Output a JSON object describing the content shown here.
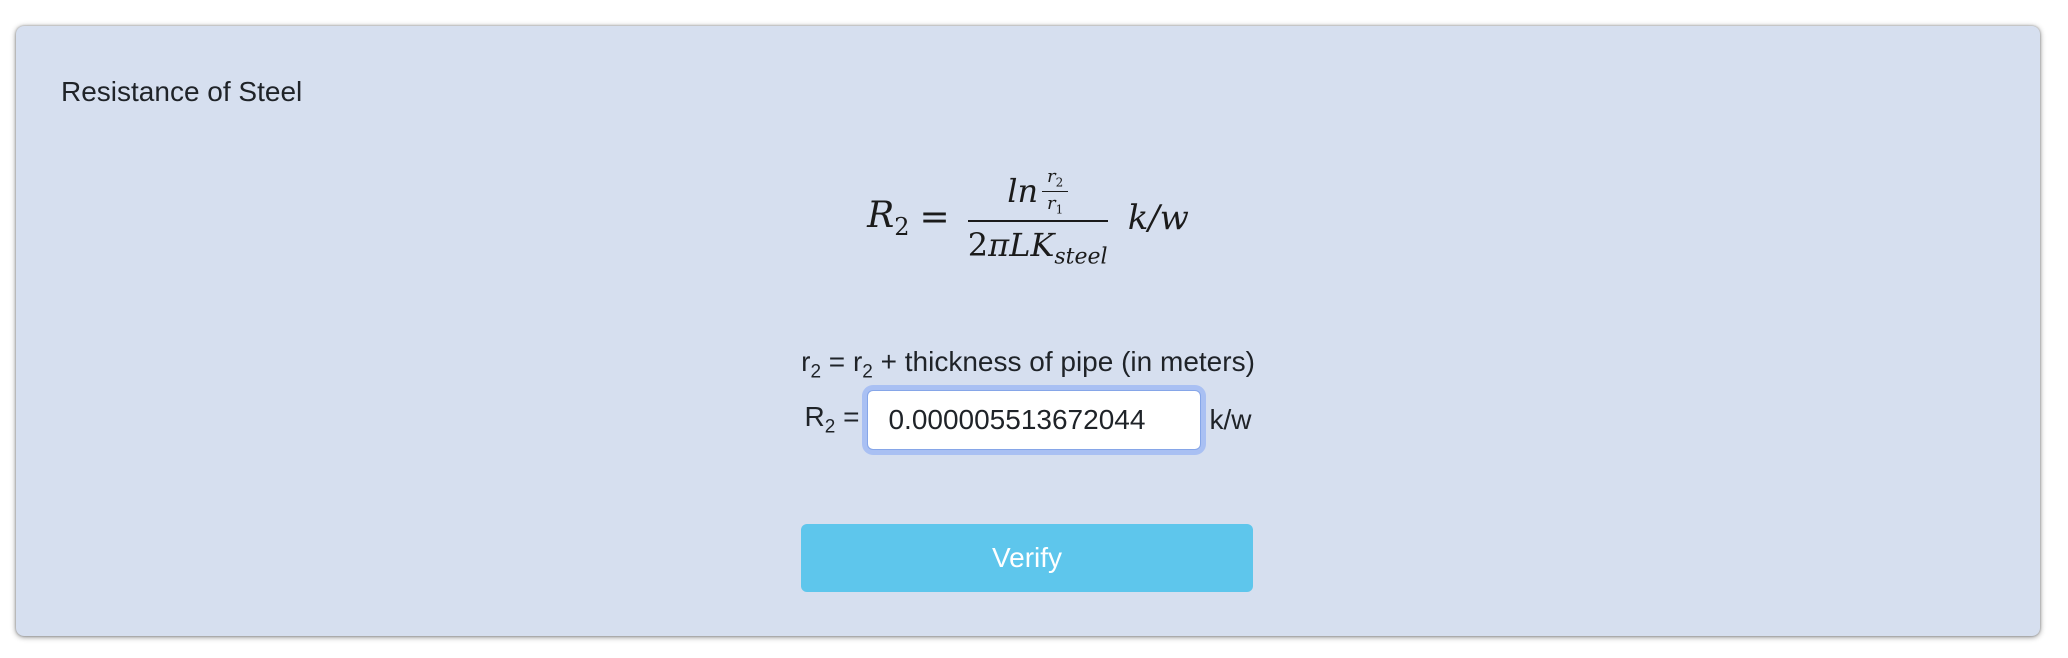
{
  "card": {
    "title": "Resistance of Steel"
  },
  "formula": {
    "lhs_symbol": "R",
    "lhs_sub": "2",
    "equals": "=",
    "num_ln": "ln",
    "num_top_var": "r",
    "num_top_sub": "2",
    "num_bottom_var": "r",
    "num_bottom_sub": "1",
    "den_two": "2",
    "den_body": "πLK",
    "den_sub": "steel",
    "unit": "k/w"
  },
  "note": {
    "left_var": "r",
    "left_sub": "2",
    "mid": " = ",
    "right_var": "r",
    "right_sub": "2",
    "rest": " + thickness of pipe (in meters)"
  },
  "answer": {
    "label_var": "R",
    "label_sub": "2",
    "label_eq": " =",
    "value": "0.000005513672044",
    "unit": "k/w"
  },
  "verify_button": {
    "label": "Verify"
  },
  "colors": {
    "card_bg": "#d6dfef",
    "button_bg": "#5ec6ec",
    "input_focus_ring": "#a9c0f3"
  }
}
